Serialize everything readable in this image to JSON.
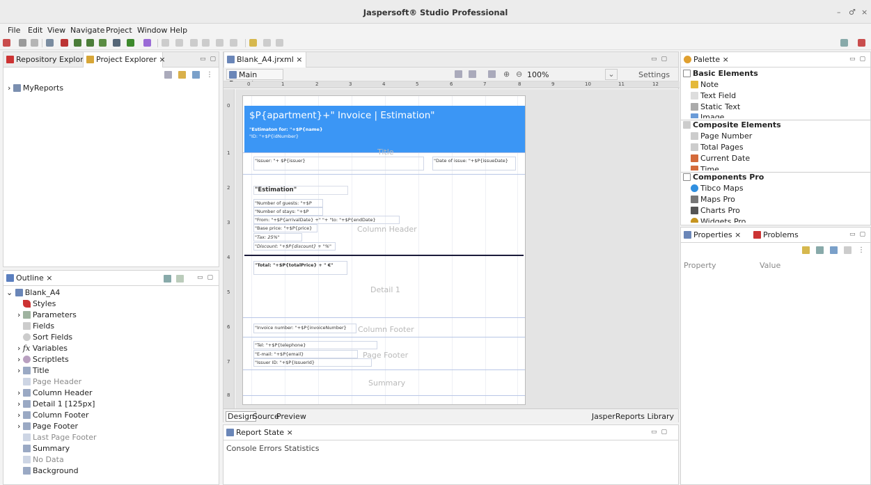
{
  "window": {
    "title": "Jaspersoft® Studio Professional",
    "controls": [
      "–",
      "♂",
      "×"
    ]
  },
  "menu": [
    "File",
    "Edit",
    "View",
    "Navigate",
    "Project",
    "Window",
    "Help"
  ],
  "left_panel": {
    "tabs": [
      "Repository Explorer",
      "Project Explorer"
    ],
    "tree": [
      {
        "label": "MyReports"
      }
    ]
  },
  "outline": {
    "tab": "Outline",
    "root": "Blank_A4",
    "items": [
      "Styles",
      "Parameters",
      "Fields",
      "Sort Fields",
      "Variables",
      "Scriptlets",
      "Title",
      "Page Header",
      "Column Header",
      "Detail 1 [125px]",
      "Column Footer",
      "Page Footer",
      "Last Page Footer",
      "Summary",
      "No Data",
      "Background"
    ]
  },
  "editor": {
    "tab": "Blank_A4.jrxml",
    "main_report": "Main Report",
    "zoom": "100%",
    "settings": "Settings",
    "ruler": [
      "0",
      "1",
      "2",
      "3",
      "4",
      "5",
      "6",
      "7",
      "8",
      "9",
      "10",
      "11",
      "12"
    ],
    "vruler": [
      "0",
      "1",
      "2",
      "3",
      "4",
      "5",
      "6",
      "7",
      "8"
    ],
    "bottom_tabs": [
      "Design",
      "Source",
      "Preview"
    ],
    "library": "JasperReports Library"
  },
  "report": {
    "title_expr": "$P{apartment}+\" Invoice | Estimation\"",
    "estimation_for": "\"Estimaton for: \"+$P{name}",
    "id": "\"ID: \"+$P{idNumber}",
    "band_title": "Title",
    "issuer": "\"Issuer: \"+ $P{issuer}",
    "date_issue": "\"Date of issue: \"+$P{issueDate}",
    "estimation": "\"Estimation\"",
    "guests": "\"Number of guests: \"+$P",
    "stays": "\"Number of stays: \"+$P",
    "from": "\"From: \"+$P{arrivalDate} +\" \"+ \"to: \"+$P{endDate}",
    "base": "\"Base price: \"+$P{price}",
    "tax": "\"Tax: 25%\"",
    "discount": "\"Discount: \"+$P{discount} + \"%\"",
    "band_column_header": "Column Header",
    "total": "\"Total: \"+$P{totalPrice} + \" €\"",
    "band_detail": "Detail 1",
    "invoice": "\"Invoice number: \"+$P{invoiceNumber}",
    "band_column_footer": "Column Footer",
    "tel": "\"Tel: \"+$P{telephone}",
    "email": "\"E-mail: \"+$P{email}",
    "issuer_id": "\"Issuer ID: \"+$P{IssuerId}",
    "band_page_footer": "Page Footer",
    "band_summary": "Summary"
  },
  "report_state": {
    "tab": "Report State",
    "stats": "Console Errors Statistics"
  },
  "palette": {
    "tab": "Palette",
    "basic": {
      "header": "Basic Elements",
      "items": [
        "Note",
        "Text Field",
        "Static Text",
        "Image"
      ]
    },
    "composite": {
      "header": "Composite Elements",
      "items": [
        "Page Number",
        "Total Pages",
        "Current Date",
        "Time"
      ]
    },
    "pro": {
      "header": "Components Pro",
      "items": [
        "Tibco Maps",
        "Maps Pro",
        "Charts Pro",
        "Widgets Pro"
      ]
    }
  },
  "properties": {
    "tabs": [
      "Properties",
      "Problems"
    ],
    "col1": "Property",
    "col2": "Value"
  },
  "colors": {
    "title_band": "#3b96f5",
    "accent": "#2a6fd6"
  }
}
